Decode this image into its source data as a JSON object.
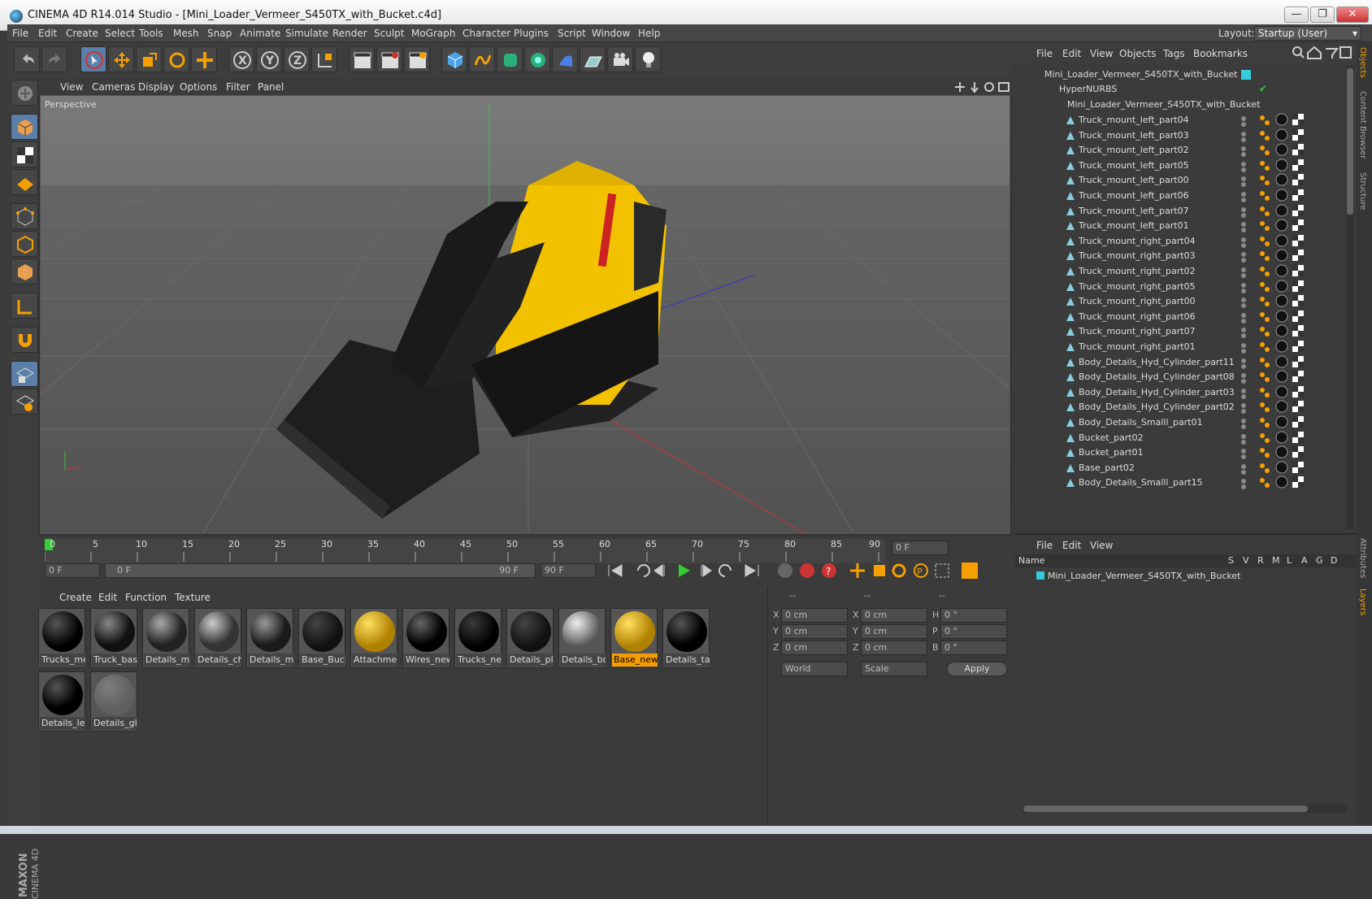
{
  "window": {
    "title": "CINEMA 4D R14.014 Studio - [Mini_Loader_Vermeer_S450TX_with_Bucket.c4d]",
    "min": "—",
    "max": "❐",
    "close": "✕"
  },
  "menu": {
    "items": [
      "File",
      "Edit",
      "Create",
      "Select",
      "Tools",
      "Mesh",
      "Snap",
      "Animate",
      "Simulate",
      "Render",
      "Sculpt",
      "MoGraph",
      "Character",
      "Plugins",
      "Script",
      "Window",
      "Help"
    ],
    "layout_label": "Layout:",
    "layout_value": "Startup (User)"
  },
  "viewport": {
    "menu": [
      "View",
      "Cameras",
      "Display",
      "Options",
      "Filter",
      "Panel"
    ],
    "label": "Perspective"
  },
  "timeline": {
    "ticks": [
      "0",
      "5",
      "10",
      "15",
      "20",
      "25",
      "30",
      "35",
      "40",
      "45",
      "50",
      "55",
      "60",
      "65",
      "70",
      "75",
      "80",
      "85",
      "90"
    ],
    "current_frame": "0 F",
    "start_frame": "0 F",
    "range_start": "0 F",
    "range_end": "90 F",
    "end_frame": "90 F"
  },
  "materials": {
    "menu": [
      "Create",
      "Edit",
      "Function",
      "Texture"
    ],
    "items": [
      "Trucks_met",
      "Truck_base",
      "Details_me",
      "Details_chr",
      "Details_me",
      "Base_Bucke",
      "Attachmen",
      "Wires_new",
      "Trucks_new",
      "Details_pla",
      "Details_bol",
      "Base_new_",
      "Details_tan",
      "Details_lea",
      "Details_gla"
    ]
  },
  "attributes": {
    "headers": [
      "--",
      "--",
      "--"
    ],
    "labels": {
      "x": "X",
      "y": "Y",
      "z": "Z",
      "x2": "X",
      "y2": "Y",
      "z2": "Z",
      "h": "H",
      "p": "P",
      "b": "B"
    },
    "values": {
      "pos": "0 cm",
      "rot": "0 °"
    },
    "coord_mode": "World",
    "scale_mode": "Scale",
    "apply": "Apply"
  },
  "objects": {
    "menu": [
      "File",
      "Edit",
      "View",
      "Objects",
      "Tags",
      "Bookmarks"
    ],
    "root": "Mini_Loader_Vermeer_S450TX_with_Bucket",
    "nurbs": "HyperNURBS",
    "group": "Mini_Loader_Vermeer_S450TX_with_Bucket",
    "items": [
      "Truck_mount_left_part04",
      "Truck_mount_left_part03",
      "Truck_mount_left_part02",
      "Truck_mount_left_part05",
      "Truck_mount_left_part00",
      "Truck_mount_left_part06",
      "Truck_mount_left_part07",
      "Truck_mount_left_part01",
      "Truck_mount_right_part04",
      "Truck_mount_right_part03",
      "Truck_mount_right_part02",
      "Truck_mount_right_part05",
      "Truck_mount_right_part00",
      "Truck_mount_right_part06",
      "Truck_mount_right_part07",
      "Truck_mount_right_part01",
      "Body_Details_Hyd_Cylinder_part11",
      "Body_Details_Hyd_Cylinder_part08",
      "Body_Details_Hyd_Cylinder_part03",
      "Body_Details_Hyd_Cylinder_part02",
      "Body_Details_Smalll_part01",
      "Bucket_part02",
      "Bucket_part01",
      "Base_part02",
      "Body_Details_Smalll_part15"
    ]
  },
  "layers": {
    "menu": [
      "File",
      "Edit",
      "View"
    ],
    "cols": [
      "Name",
      "S",
      "V",
      "R",
      "M",
      "L",
      "A",
      "G",
      "D"
    ],
    "item": "Mini_Loader_Vermeer_S450TX_with_Bucket"
  },
  "sidetabs": [
    "Objects",
    "Content Browser",
    "Structure",
    "Attributes",
    "Layers"
  ],
  "brand": {
    "maxon": "MAXON",
    "c4d": "CINEMA 4D"
  },
  "colors": {
    "accent": "#f59c00",
    "selected": "#5b7fa8",
    "yellow": "#f2c200"
  }
}
